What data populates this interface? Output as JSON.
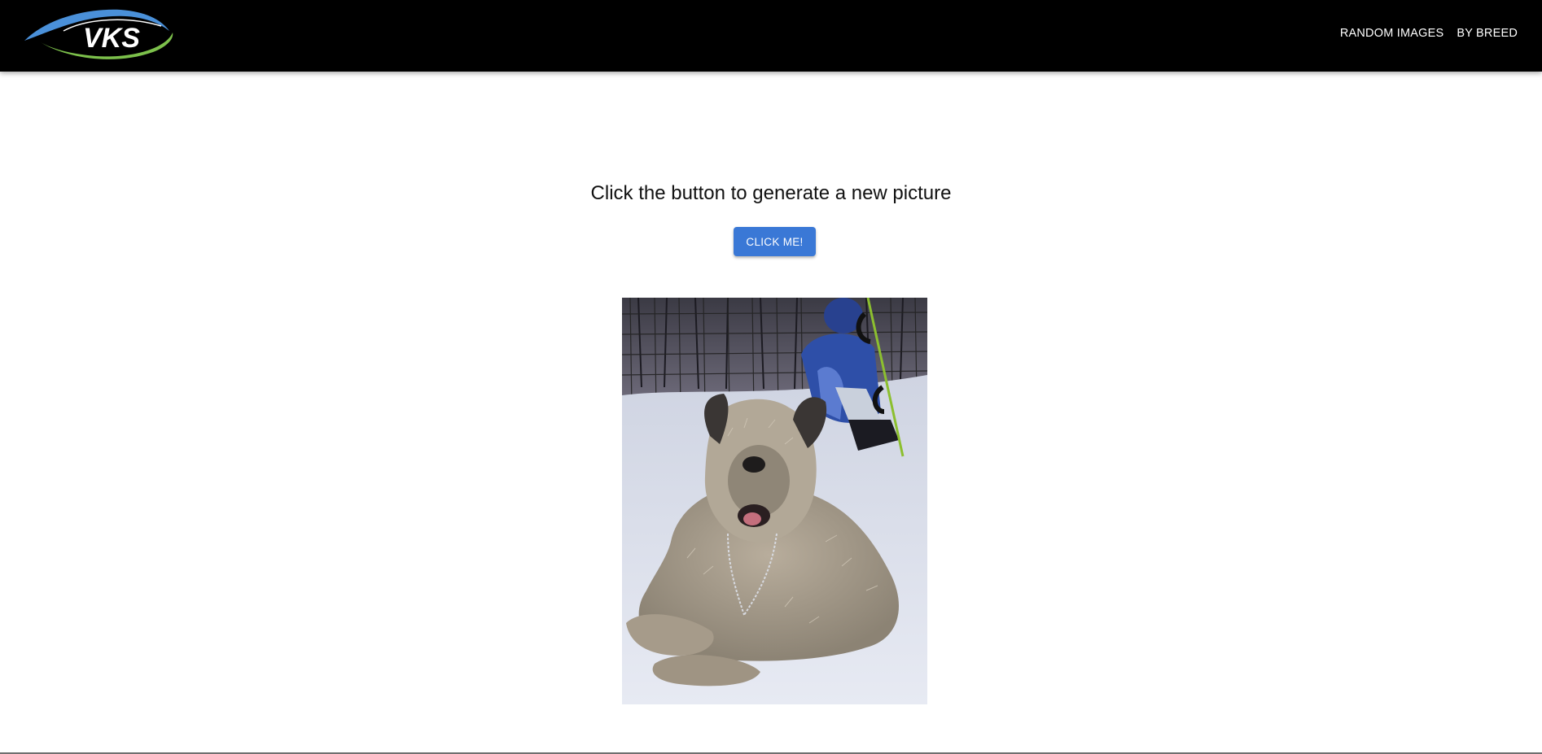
{
  "app_bar": {
    "logo_text": "VKS",
    "nav": [
      {
        "label": "RANDOM IMAGES"
      },
      {
        "label": "BY BREED"
      }
    ]
  },
  "main": {
    "heading": "Click the button to generate a new picture",
    "button_label": "CLICK ME!",
    "image_alt": ""
  },
  "colors": {
    "app_bar_bg": "#000000",
    "button_bg": "#3a78d6",
    "logo_blue": "#4a90d9",
    "logo_green": "#7cc04b"
  }
}
